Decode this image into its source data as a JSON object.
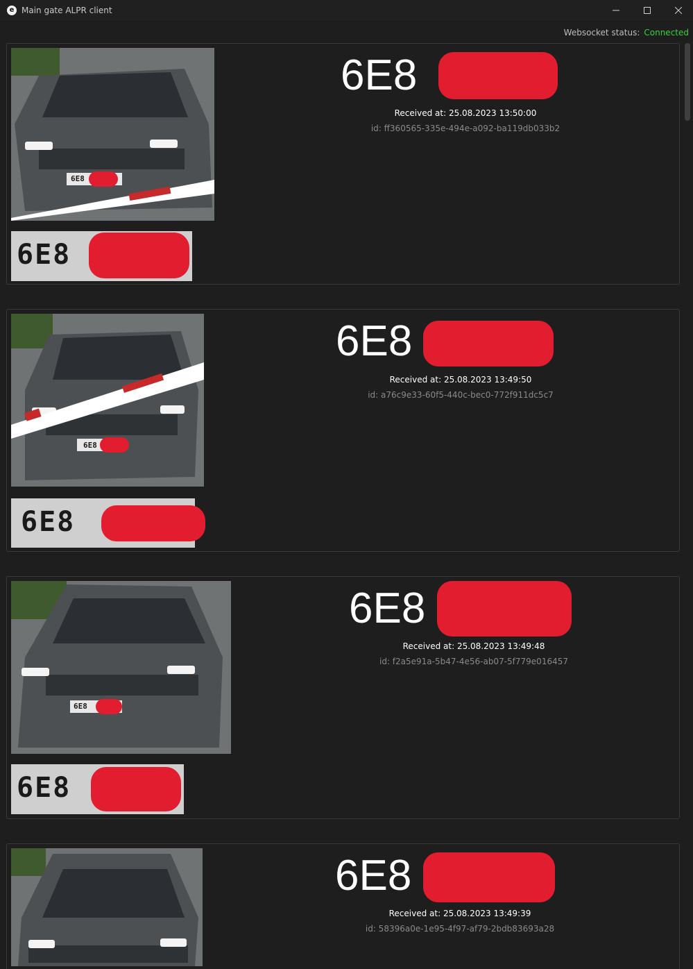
{
  "window": {
    "app_icon": "e",
    "title": "Main gate ALPR client"
  },
  "status": {
    "label": "Websocket status:",
    "value": "Connected",
    "value_color": "#3ad13a"
  },
  "records": [
    {
      "plate_visible": "6E8",
      "plate_crop_text": "6E8",
      "plate_small": "6E8",
      "received": "Received at: 25.08.2023 13:50:00",
      "id": "id: ff360565-335e-494e-a092-ba119db033b2"
    },
    {
      "plate_visible": "6E8",
      "plate_crop_text": "6E8",
      "plate_small": "6E8",
      "received": "Received at: 25.08.2023 13:49:50",
      "id": "id: a76c9e33-60f5-440c-bec0-772f911dc5c7"
    },
    {
      "plate_visible": "6E8",
      "plate_crop_text": "6E8",
      "plate_small": "6E8",
      "received": "Received at: 25.08.2023 13:49:48",
      "id": "id: f2a5e91a-5b47-4e56-ab07-5f779e016457"
    },
    {
      "plate_visible": "6E8",
      "plate_crop_text": "",
      "plate_small": "",
      "received": "Received at: 25.08.2023 13:49:39",
      "id": "id: 58396a0e-1e95-4f97-af79-2bdb83693a28"
    }
  ],
  "colors": {
    "background": "#1e1e1e",
    "redaction": "#e11d2f"
  }
}
